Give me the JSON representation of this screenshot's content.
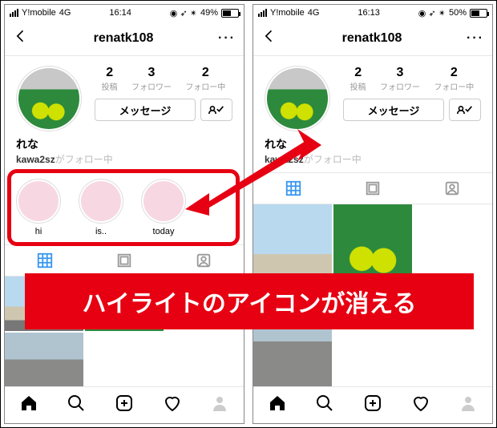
{
  "overlay": {
    "banner_text": "ハイライトのアイコンが消える"
  },
  "left": {
    "status": {
      "carrier": "Y!mobile",
      "net": "4G",
      "time": "16:14",
      "batt_pct": "49%",
      "batt_fill": 49
    },
    "nav": {
      "title": "renatk108"
    },
    "stats": {
      "posts_n": "2",
      "posts_l": "投稿",
      "followers_n": "3",
      "followers_l": "フォロワー",
      "following_n": "2",
      "following_l": "フォロー中"
    },
    "msg_btn": "メッセージ",
    "display_name": "れな",
    "followed_by_user": "kawa2sz",
    "followed_by_suffix": "がフォロー中",
    "highlights": [
      {
        "label": "hi"
      },
      {
        "label": "is.."
      },
      {
        "label": "today"
      }
    ]
  },
  "right": {
    "status": {
      "carrier": "Y!mobile",
      "net": "4G",
      "time": "16:13",
      "batt_pct": "50%",
      "batt_fill": 50
    },
    "nav": {
      "title": "renatk108"
    },
    "stats": {
      "posts_n": "2",
      "posts_l": "投稿",
      "followers_n": "3",
      "followers_l": "フォロワー",
      "following_n": "2",
      "following_l": "フォロー中"
    },
    "msg_btn": "メッセージ",
    "display_name": "れな",
    "followed_by_user": "kawa2sz",
    "followed_by_suffix": "がフォロー中"
  }
}
